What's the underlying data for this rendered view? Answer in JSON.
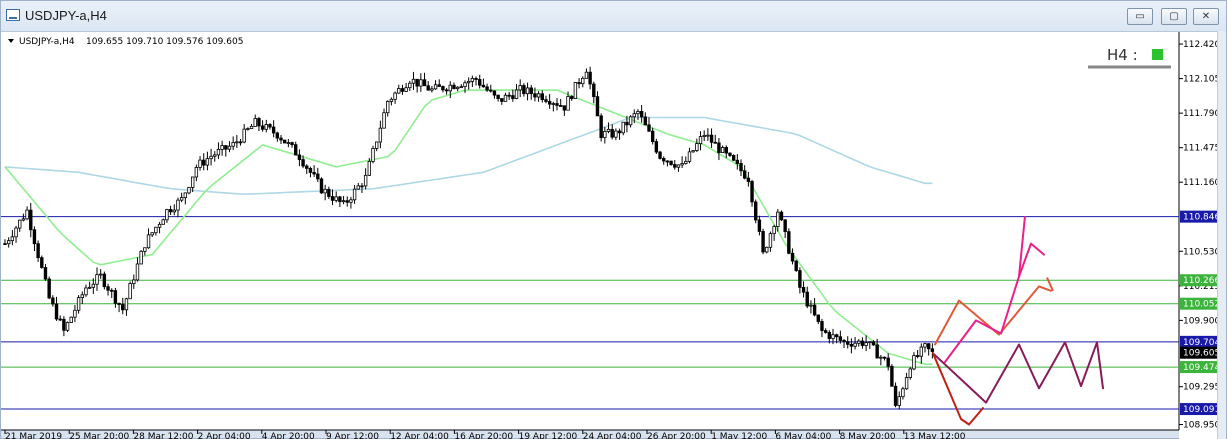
{
  "window": {
    "title": "USDJPY-a,H4",
    "minimize_glyph": "▭",
    "maximize_glyph": "▢",
    "close_glyph": "✕"
  },
  "indicator": {
    "text": "H4 :",
    "color": "#2ec22e"
  },
  "colors": {
    "bull": "#000000",
    "bear": "#000000",
    "ma_fast": "#90ee90",
    "ma_slow": "#add8e6",
    "support_blue": "#1a1aaa",
    "support_green": "#3cb43c",
    "pink": "#e8208a",
    "orange": "#e05a3a",
    "purple": "#8a1a5a",
    "red": "#c02010"
  },
  "chart_data": {
    "type": "candlestick",
    "symbol": "USDJPY-a,H4",
    "header_values": "109.655 109.710 109.576 109.605",
    "ylim": [
      108.9,
      112.53
    ],
    "y_ticks": [
      "112.420",
      "112.105",
      "111.790",
      "111.475",
      "111.160",
      "110.530",
      "110.215",
      "109.900",
      "109.295",
      "108.950"
    ],
    "x_ticks": [
      "21 Mar 2019",
      "25 Mar 20:00",
      "28 Mar 12:00",
      "2 Apr 04:00",
      "4 Apr 20:00",
      "9 Apr 12:00",
      "12 Apr 04:00",
      "16 Apr 20:00",
      "19 Apr 12:00",
      "24 Apr 04:00",
      "26 Apr 20:00",
      "1 May 12:00",
      "6 May 04:00",
      "8 May 20:00",
      "13 May 12:00"
    ],
    "levels": [
      {
        "price": 110.846,
        "label": "110.846",
        "kind": "blue"
      },
      {
        "price": 110.266,
        "label": "110.266",
        "kind": "green"
      },
      {
        "price": 110.052,
        "label": "110.052",
        "kind": "green"
      },
      {
        "price": 109.704,
        "label": "109.704",
        "kind": "blue"
      },
      {
        "price": 109.474,
        "label": "109.474",
        "kind": "green"
      },
      {
        "price": 109.091,
        "label": "109.091",
        "kind": "blue"
      }
    ],
    "current_price": "109.605",
    "anchors": [
      [
        0,
        110.6
      ],
      [
        6,
        110.9
      ],
      [
        12,
        110.1
      ],
      [
        16,
        109.8
      ],
      [
        22,
        110.2
      ],
      [
        26,
        110.3
      ],
      [
        32,
        110.0
      ],
      [
        38,
        110.6
      ],
      [
        44,
        110.9
      ],
      [
        48,
        111.0
      ],
      [
        52,
        111.3
      ],
      [
        56,
        111.4
      ],
      [
        62,
        111.5
      ],
      [
        68,
        111.7
      ],
      [
        74,
        111.6
      ],
      [
        80,
        111.4
      ],
      [
        86,
        111.1
      ],
      [
        92,
        110.95
      ],
      [
        98,
        111.2
      ],
      [
        104,
        111.9
      ],
      [
        110,
        112.1
      ],
      [
        116,
        112.0
      ],
      [
        122,
        112.05
      ],
      [
        128,
        112.1
      ],
      [
        134,
        111.9
      ],
      [
        140,
        112.0
      ],
      [
        146,
        111.95
      ],
      [
        152,
        111.85
      ],
      [
        158,
        112.2
      ],
      [
        162,
        111.6
      ],
      [
        166,
        111.6
      ],
      [
        172,
        111.8
      ],
      [
        178,
        111.4
      ],
      [
        184,
        111.3
      ],
      [
        190,
        111.6
      ],
      [
        196,
        111.4
      ],
      [
        202,
        111.2
      ],
      [
        206,
        110.5
      ],
      [
        210,
        110.9
      ],
      [
        216,
        110.2
      ],
      [
        222,
        109.8
      ],
      [
        228,
        109.7
      ],
      [
        234,
        109.7
      ],
      [
        240,
        109.5
      ],
      [
        242,
        109.1
      ],
      [
        246,
        109.5
      ],
      [
        250,
        109.65
      ],
      [
        252,
        109.6
      ]
    ],
    "ma_fast": [
      [
        0,
        111.3
      ],
      [
        15,
        110.7
      ],
      [
        25,
        110.4
      ],
      [
        40,
        110.5
      ],
      [
        55,
        111.1
      ],
      [
        70,
        111.5
      ],
      [
        90,
        111.3
      ],
      [
        105,
        111.4
      ],
      [
        115,
        111.9
      ],
      [
        125,
        112.0
      ],
      [
        150,
        112.0
      ],
      [
        165,
        111.8
      ],
      [
        180,
        111.6
      ],
      [
        190,
        111.5
      ],
      [
        200,
        111.3
      ],
      [
        212,
        110.6
      ],
      [
        225,
        110.0
      ],
      [
        240,
        109.6
      ],
      [
        250,
        109.5
      ]
    ],
    "ma_slow": [
      [
        0,
        111.3
      ],
      [
        20,
        111.25
      ],
      [
        45,
        111.1
      ],
      [
        65,
        111.05
      ],
      [
        100,
        111.1
      ],
      [
        130,
        111.25
      ],
      [
        150,
        111.5
      ],
      [
        170,
        111.75
      ],
      [
        190,
        111.75
      ],
      [
        215,
        111.6
      ],
      [
        235,
        111.3
      ],
      [
        250,
        111.15
      ]
    ],
    "sketch_pink": [
      [
        109.52
      ],
      [
        109.9
      ],
      [
        109.78
      ],
      [
        110.3
      ],
      [
        110.6
      ],
      [
        110.5
      ]
    ],
    "sketch_orange": [
      [
        109.68
      ],
      [
        110.08
      ],
      [
        109.77
      ],
      [
        110.21
      ],
      [
        110.17
      ]
    ],
    "sketch_purple": [
      [
        109.6
      ],
      [
        109.15
      ],
      [
        109.68
      ],
      [
        109.28
      ],
      [
        109.7
      ],
      [
        109.3
      ],
      [
        109.7
      ],
      [
        109.28
      ]
    ],
    "sketch_red": [
      [
        109.6
      ],
      [
        109.0
      ],
      [
        108.95
      ],
      [
        109.1
      ]
    ]
  }
}
